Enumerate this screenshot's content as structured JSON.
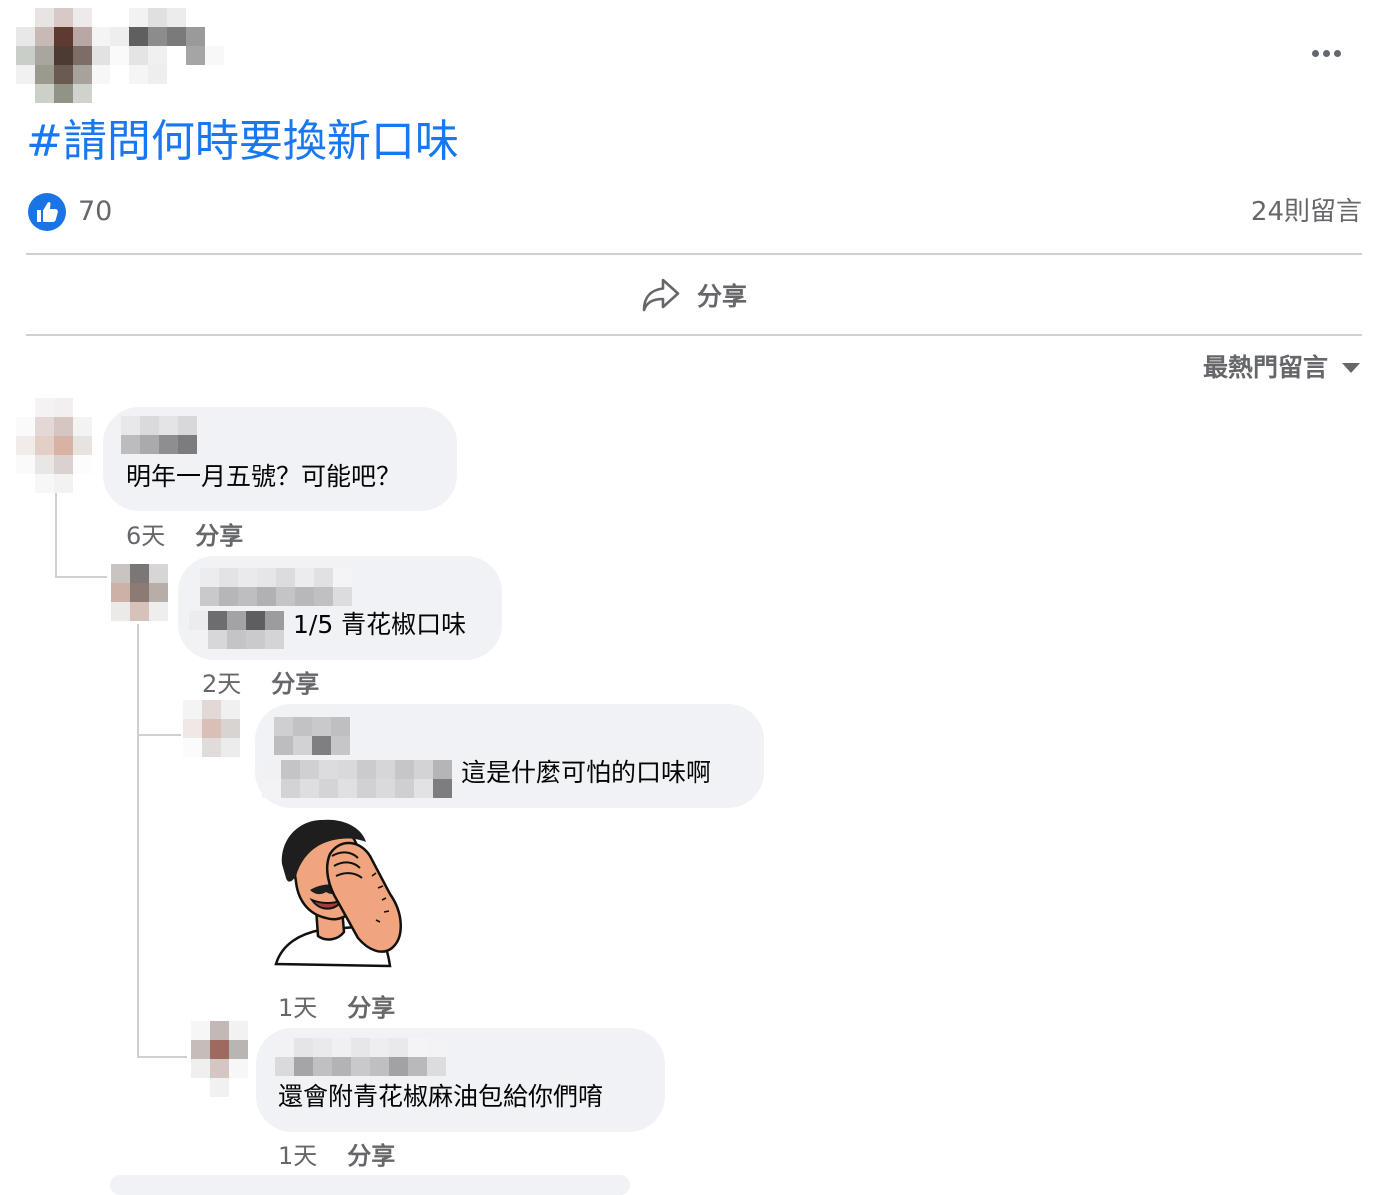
{
  "post": {
    "hashtag": "#請問何時要換新口味",
    "like_count": "70",
    "comment_count": "24則留言",
    "share_label": "分享",
    "sort_label": "最熱門留言"
  },
  "comments": [
    {
      "text": "明年一月五號？可能吧？",
      "time": "6天",
      "share": "分享"
    },
    {
      "text": "1/5 青花椒口味",
      "time": "2天",
      "share": "分享"
    },
    {
      "text": "這是什麼可怕的口味啊",
      "time": "1天",
      "share": "分享",
      "sticker": "facepalm-sticker"
    },
    {
      "text": "還會附青花椒麻油包給你們唷",
      "time": "1天",
      "share": "分享"
    }
  ],
  "colors": {
    "link_blue": "#1877f2",
    "like_blue": "#1b74e4",
    "bubble_gray": "#f0f2f5",
    "meta_gray": "#65676b"
  },
  "icons": [
    "more-options-icon",
    "like-icon",
    "share-icon",
    "dropdown-caret-icon"
  ]
}
